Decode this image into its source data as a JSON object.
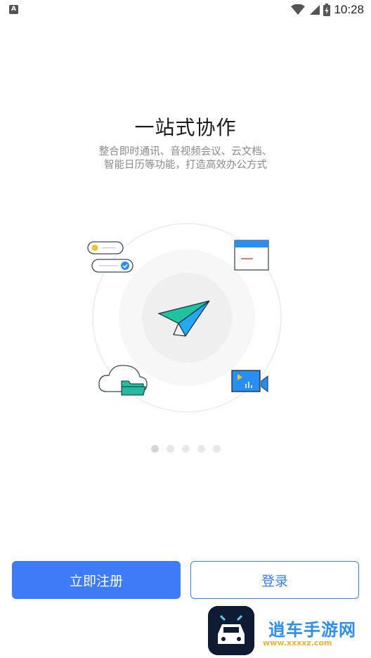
{
  "status_bar": {
    "app_indicator": "A",
    "time": "10:28",
    "icons": [
      "wifi-icon",
      "signal-icon",
      "battery-charging-icon"
    ]
  },
  "onboarding": {
    "title": "一站式协作",
    "subtitle_line1": "整合即时通讯、音视频会议、云文档、",
    "subtitle_line2": "智能日历等功能，打造高效办公方式",
    "illustration_icons": [
      "paper-plane-icon",
      "chat-bubbles-icon",
      "calendar-window-icon",
      "cloud-folder-icon",
      "video-player-icon"
    ],
    "pager": {
      "total": 5,
      "current": 1
    }
  },
  "actions": {
    "register_label": "立即注册",
    "login_label": "登录"
  },
  "watermark": {
    "text": "逍车手游网",
    "url": "www.xxxxz.com"
  },
  "colors": {
    "accent": "#3d7cf6",
    "title": "#1b1b1b",
    "subtitle": "#8a8a8a",
    "plane_green": "#1fc3a0",
    "plane_blue": "#27a6f2"
  }
}
